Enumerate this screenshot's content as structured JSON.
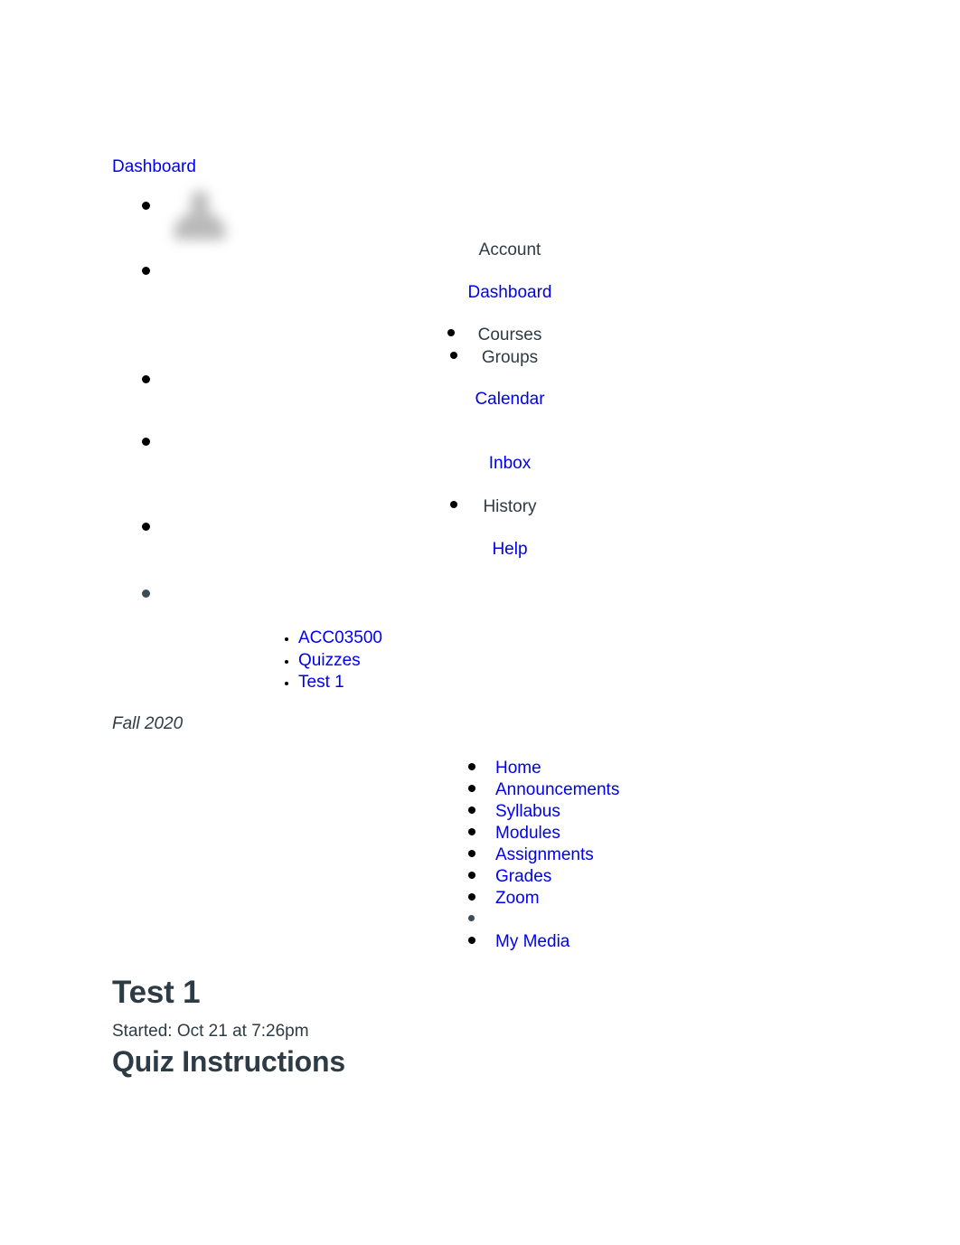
{
  "global_nav": {
    "dashboard_link": "Dashboard",
    "avatar_alt": "user-avatar-placeholder",
    "items": [
      {
        "label": "Account",
        "is_link": false
      },
      {
        "label": "Dashboard",
        "is_link": true
      },
      {
        "label": "Courses",
        "is_link": false
      },
      {
        "label": "Groups",
        "is_link": false
      },
      {
        "label": "Calendar",
        "is_link": true
      },
      {
        "label": "Inbox",
        "is_link": true
      },
      {
        "label": "History",
        "is_link": false
      },
      {
        "label": "Help",
        "is_link": true
      }
    ]
  },
  "breadcrumbs": [
    {
      "label": "ACC03500"
    },
    {
      "label": "Quizzes"
    },
    {
      "label": "Test 1"
    }
  ],
  "term": "Fall 2020",
  "course_nav": [
    {
      "label": "Home",
      "is_link": true
    },
    {
      "label": "Announcements",
      "is_link": true
    },
    {
      "label": "Syllabus",
      "is_link": true
    },
    {
      "label": "Modules",
      "is_link": true
    },
    {
      "label": "Assignments",
      "is_link": true
    },
    {
      "label": "Grades",
      "is_link": true
    },
    {
      "label": "Zoom",
      "is_link": true
    },
    {
      "label": "",
      "is_link": false
    },
    {
      "label": "My Media",
      "is_link": true
    }
  ],
  "main": {
    "title": "Test 1",
    "started": "Started: Oct 21 at 7:26pm",
    "instructions_heading": "Quiz Instructions"
  },
  "colors": {
    "link": "#0000EE",
    "text": "#2D3B45",
    "background": "#FFFFFF",
    "bullet": "#000000"
  }
}
